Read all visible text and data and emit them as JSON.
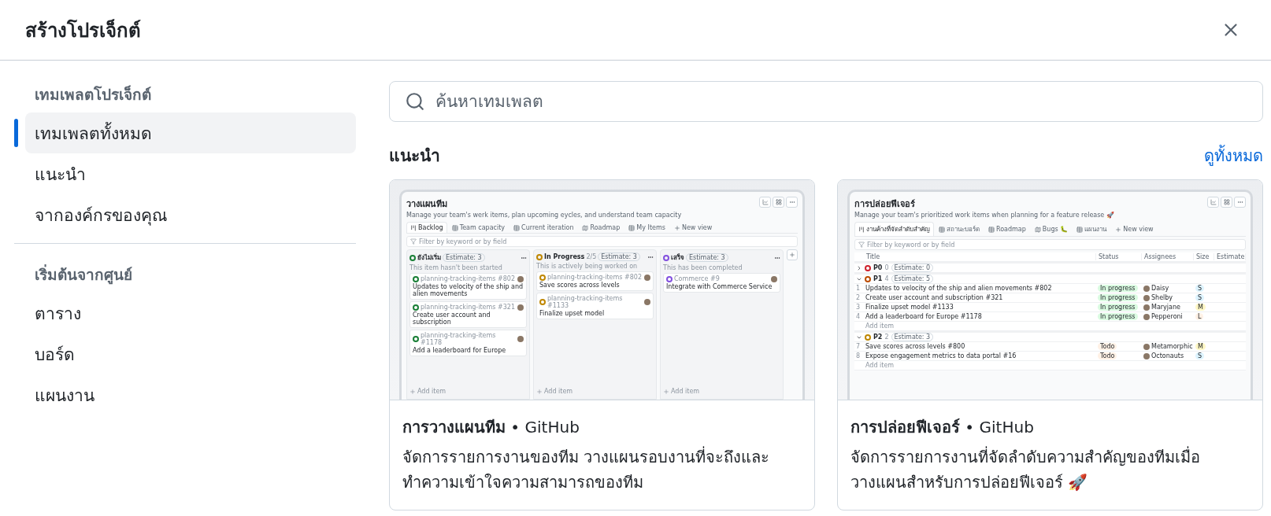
{
  "dialog": {
    "title": "สร้างโปรเจ็กต์"
  },
  "sidebar": {
    "sections": [
      {
        "heading": "เทมเพลตโปรเจ็กต์",
        "items": [
          {
            "label": "เทมเพลตทั้งหมด",
            "selected": true
          },
          {
            "label": "แนะนำ",
            "selected": false
          },
          {
            "label": "จากองค์กรของคุณ",
            "selected": false
          }
        ]
      },
      {
        "heading": "เริ่มต้นจากศูนย์",
        "items": [
          {
            "label": "ตาราง",
            "selected": false
          },
          {
            "label": "บอร์ด",
            "selected": false
          },
          {
            "label": "แผนงาน",
            "selected": false
          }
        ]
      }
    ]
  },
  "search": {
    "placeholder": "ค้นหาเทมเพลต"
  },
  "section": {
    "title": "แนะนำ",
    "link": "ดูทั้งหมด"
  },
  "templates": [
    {
      "kind": "board",
      "name": "การวางแผนทีม",
      "separator": "•",
      "author": "GitHub",
      "description": "จัดการรายการงานของทีม วางแผนรอบงานที่จะถึงและทำความเข้าใจความสามารถของทีม",
      "preview": {
        "title": "วางแผนทีม",
        "subtitle": "Manage your team's werk items, plan upcoming eycles, and understand team capacity",
        "tabs": [
          {
            "label": "Backlog",
            "selected": true
          },
          {
            "label": "Team capacity",
            "selected": false
          },
          {
            "label": "Current iteration",
            "selected": false
          },
          {
            "label": "Roadmap",
            "selected": false
          },
          {
            "label": "My Items",
            "selected": false
          }
        ],
        "new_view": "New view",
        "filter_placeholder": "Filter by keyword or by field",
        "columns": [
          {
            "name": "ยังไม่เริ่ม",
            "color": "#1a7f37",
            "badge": "Estimate: 3",
            "note": "This item hasn't been started",
            "cards": [
              {
                "meta": "planning-tracking-items #802",
                "title": "Updates to velocity of the ship and alien movements"
              },
              {
                "meta": "planning-tracking-items #321",
                "title": "Create user account and subscription"
              },
              {
                "meta": "planning-tracking-items #1178",
                "title": "Add a leaderboard for Europe"
              }
            ],
            "add": "Add item"
          },
          {
            "name": "In Progress",
            "count": "2/5",
            "color": "#bf8700",
            "badge": "Estimate: 3",
            "note": "This is actively being worked on",
            "cards": [
              {
                "meta": "planning-tracking-items #802",
                "title": "Save scores across levels"
              },
              {
                "meta": "planning-tracking-items #1133",
                "title": "Finalize upset model"
              }
            ],
            "add": "Add item"
          },
          {
            "name": "เสร็จ",
            "color": "#8250df",
            "badge": "Estimate: 3",
            "note": "This has been completed",
            "cards": [
              {
                "meta": "Commerce #9",
                "title": "Integrate with Commerce Service"
              }
            ],
            "add": "Add item"
          }
        ]
      }
    },
    {
      "kind": "table",
      "name": "การปล่อยฟีเจอร์",
      "separator": "•",
      "author": "GitHub",
      "description": "จัดการรายการงานที่จัดลำดับความสำคัญของทีมเมื่อวางแผนสำหรับการปล่อยฟีเจอร์ 🚀",
      "preview": {
        "title": "การปล่อยฟีเจอร์",
        "subtitle": "Manage your team's prioritized work items when planning for a feature release 🚀",
        "tabs": [
          {
            "label": "งานค้างที่จัดลำดับสำคัญ",
            "selected": true
          },
          {
            "label": "สถานะบอร์ด",
            "selected": false
          },
          {
            "label": "Roadmap",
            "selected": false
          },
          {
            "label": "Bugs 🐛",
            "selected": false
          },
          {
            "label": "แผนงาน",
            "selected": false
          }
        ],
        "new_view": "New view",
        "filter_placeholder": "Filter by keyword or by field",
        "headers": [
          "Title",
          "Status",
          "Assignees",
          "Size",
          "Estimate"
        ],
        "groups": [
          {
            "name": "P0",
            "count": "0",
            "badge": "Estimate: 0",
            "color": "#cf222e",
            "expanded": false
          },
          {
            "name": "P1",
            "count": "4",
            "badge": "Estimate: 5",
            "color": "#bc4c00",
            "expanded": true,
            "add": "Add item",
            "rows": [
              {
                "number": "1",
                "title": "Updates to velocity of the ship and alien movements #802",
                "status": {
                  "text": "In progress",
                  "color": "#dafbe1"
                },
                "assignee": "Daisy",
                "size": {
                  "text": "S",
                  "color": "#ddf4ff"
                }
              },
              {
                "number": "2",
                "title": "Create user account and subscription #321",
                "status": {
                  "text": "In progress",
                  "color": "#dafbe1"
                },
                "assignee": "Shelby",
                "size": {
                  "text": "S",
                  "color": "#ddf4ff"
                }
              },
              {
                "number": "3",
                "title": "Finalize upset model #1133",
                "status": {
                  "text": "In progress",
                  "color": "#dafbe1"
                },
                "assignee": "Maryjane",
                "size": {
                  "text": "M",
                  "color": "#fff8c5"
                }
              },
              {
                "number": "4",
                "title": "Add a leaderboard for Europe #1178",
                "status": {
                  "text": "In progress",
                  "color": "#dafbe1"
                },
                "assignee": "Pepperoni",
                "size": {
                  "text": "L",
                  "color": "#fff1e5"
                }
              }
            ]
          },
          {
            "name": "P2",
            "count": "2",
            "badge": "Estimate: 3",
            "color": "#bf8700",
            "expanded": true,
            "add": "Add item",
            "rows": [
              {
                "number": "7",
                "title": "Save scores across levels #800",
                "status": {
                  "text": "Todo",
                  "color": "#fff1e5"
                },
                "assignee": "Metamorphic",
                "size": {
                  "text": "M",
                  "color": "#fff8c5"
                }
              },
              {
                "number": "8",
                "title": "Expose engagement metrics to data portal #16",
                "status": {
                  "text": "Todo",
                  "color": "#fff1e5"
                },
                "assignee": "Octonauts",
                "size": {
                  "text": "S",
                  "color": "#ddf4ff"
                }
              }
            ]
          }
        ]
      }
    }
  ]
}
